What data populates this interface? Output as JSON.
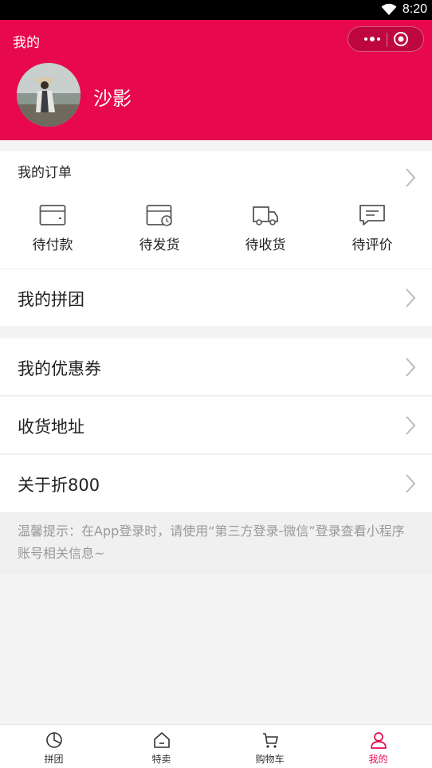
{
  "status_bar": {
    "time": "8:20"
  },
  "header": {
    "title": "我的",
    "bg_color": "#e8094d"
  },
  "profile": {
    "username": "沙影"
  },
  "orders": {
    "title": "我的订单",
    "items": [
      {
        "label": "待付款",
        "icon": "wallet-icon"
      },
      {
        "label": "待发货",
        "icon": "box-clock-icon"
      },
      {
        "label": "待收货",
        "icon": "truck-icon"
      },
      {
        "label": "待评价",
        "icon": "comment-icon"
      }
    ]
  },
  "menu": {
    "group_buy": "我的拼团",
    "coupons": "我的优惠券",
    "address": "收货地址",
    "about": "关于折800"
  },
  "tip": "温馨提示：在App登录时，请使用“第三方登录-微信”登录查看小程序账号相关信息~",
  "tabbar": {
    "accent": "#e8094d",
    "tabs": [
      {
        "label": "拼团",
        "icon": "pie-chart-icon"
      },
      {
        "label": "特卖",
        "icon": "home-icon"
      },
      {
        "label": "购物车",
        "icon": "cart-icon"
      },
      {
        "label": "我的",
        "icon": "user-icon",
        "active": true
      }
    ]
  }
}
